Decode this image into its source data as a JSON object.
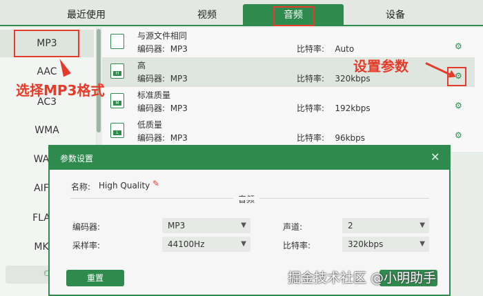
{
  "tabs": [
    {
      "label": "最近使用"
    },
    {
      "label": "视频"
    },
    {
      "label": "音频"
    },
    {
      "label": "设备"
    }
  ],
  "formats": [
    "MP3",
    "AAC",
    "AC3",
    "WMA",
    "WA",
    "AIF",
    "FLA",
    "MK"
  ],
  "presets": [
    {
      "name": "与源文件相同",
      "encoder_label": "编码器:",
      "encoder": "MP3",
      "bitrate_label": "比特率:",
      "bitrate": "Auto"
    },
    {
      "name": "高",
      "encoder_label": "编码器:",
      "encoder": "MP3",
      "bitrate_label": "比特率:",
      "bitrate": "320kbps"
    },
    {
      "name": "标准质量",
      "encoder_label": "编码器:",
      "encoder": "MP3",
      "bitrate_label": "比特率:",
      "bitrate": "192kbps"
    },
    {
      "name": "低质量",
      "encoder_label": "编码器:",
      "encoder": "MP3",
      "bitrate_label": "比特率:",
      "bitrate": "96kbps"
    }
  ],
  "annotations": {
    "left": "选择MP3格式",
    "right": "设置参数"
  },
  "dialog": {
    "title": "参数设置",
    "name_label": "名称:",
    "name_value": "High Quality",
    "section": "音频",
    "encoder_label": "编码器:",
    "encoder_value": "MP3",
    "sample_label": "采样率:",
    "sample_value": "44100Hz",
    "channel_label": "声道:",
    "channel_value": "2",
    "bitrate_label": "比特率:",
    "bitrate_value": "320kbps",
    "reset_label": "重置"
  },
  "watermark": "掘金技术社区 @小明助手",
  "colors": {
    "accent": "#2f8a4d",
    "highlight": "#e63b2a"
  }
}
